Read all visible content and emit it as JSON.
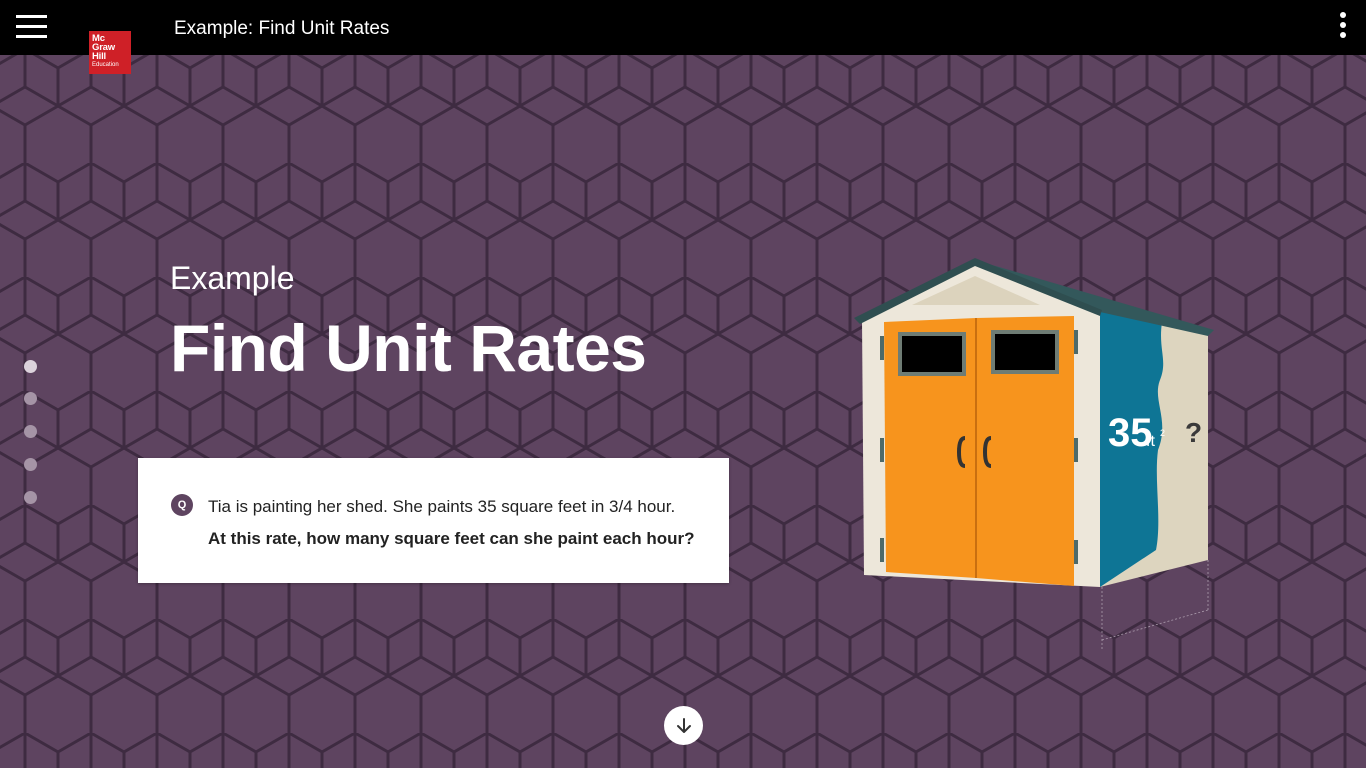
{
  "header": {
    "title": "Example: Find Unit Rates",
    "logo": {
      "line1": "Mc",
      "line2": "Graw",
      "line3": "Hill",
      "line4": "Education"
    },
    "menu_icon": "hamburger-icon",
    "more_icon": "kebab-icon"
  },
  "hero": {
    "eyebrow": "Example",
    "title": "Find Unit Rates"
  },
  "question": {
    "badge": "Q",
    "line1": "Tia is painting her shed. She paints 35 square feet in 3/4 hour.",
    "line2": "At this rate, how many square feet can she paint each hour?"
  },
  "illustration": {
    "area_value": "35",
    "area_unit": "ft",
    "area_exponent": "2",
    "unknown": "?"
  },
  "pagination": {
    "count": 5,
    "active_index": 0
  },
  "colors": {
    "background": "#5e4460",
    "pattern_line": "#3d2a40",
    "topbar": "#000000",
    "logo": "#cf2027",
    "door": "#f7941d",
    "paint": "#0e7595",
    "shed_wall": "#ede7da"
  }
}
